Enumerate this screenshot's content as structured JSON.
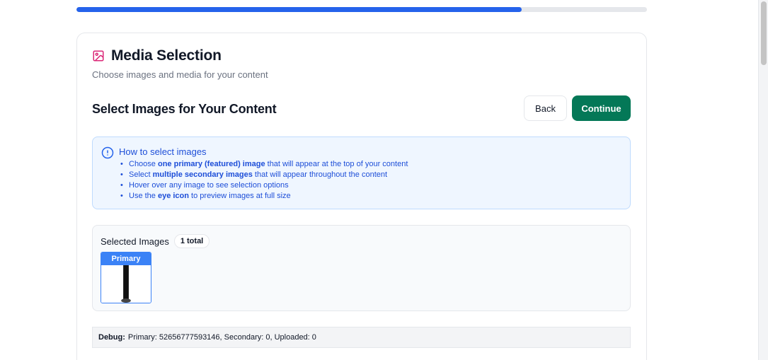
{
  "progress": {
    "value_percent": 78,
    "color": "#2563eb"
  },
  "header": {
    "icon": "image-icon",
    "icon_color": "#db2777",
    "title": "Media Selection",
    "subtitle": "Choose images and media for your content"
  },
  "section": {
    "title": "Select Images for Your Content",
    "back_label": "Back",
    "continue_label": "Continue",
    "continue_color": "#047857"
  },
  "info": {
    "icon": "info-icon",
    "title": "How to select images",
    "items": [
      {
        "pre": "Choose ",
        "bold": "one primary (featured) image",
        "post": " that will appear at the top of your content"
      },
      {
        "pre": "Select ",
        "bold": "multiple secondary images",
        "post": " that will appear throughout the content"
      },
      {
        "pre": "Hover over any image to see selection options",
        "bold": "",
        "post": ""
      },
      {
        "pre": "Use the ",
        "bold": "eye icon",
        "post": " to preview images at full size"
      }
    ]
  },
  "selected": {
    "label": "Selected Images",
    "count_badge": "1 total",
    "images": [
      {
        "tag": "Primary",
        "accent": "#3b82f6"
      }
    ]
  },
  "debug": {
    "label": "Debug:",
    "text": "Primary: 52656777593146, Secondary: 0, Uploaded: 0"
  }
}
